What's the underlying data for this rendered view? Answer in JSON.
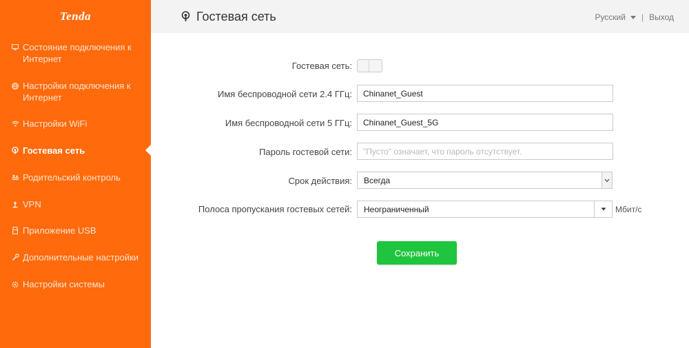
{
  "brand": {
    "logo_text": "Tenda",
    "accent_color": "#ff6a0c"
  },
  "sidebar": {
    "items": [
      {
        "label": "Состояние подключения к Интернет",
        "icon": "monitor-icon",
        "active": false
      },
      {
        "label": "Настройки подключения к Интернет",
        "icon": "globe-icon",
        "active": false
      },
      {
        "label": "Настройки WiFi",
        "icon": "wifi-icon",
        "active": false
      },
      {
        "label": "Гостевая сеть",
        "icon": "guest-network-icon",
        "active": true
      },
      {
        "label": "Родительский контроль",
        "icon": "parental-control-icon",
        "active": false
      },
      {
        "label": "VPN",
        "icon": "vpn-icon",
        "active": false
      },
      {
        "label": "Приложение USB",
        "icon": "usb-icon",
        "active": false
      },
      {
        "label": "Дополнительные настройки",
        "icon": "wrench-icon",
        "active": false
      },
      {
        "label": "Настройки системы",
        "icon": "gear-icon",
        "active": false
      }
    ]
  },
  "header": {
    "title": "Гостевая сеть",
    "title_icon": "guest-network-icon",
    "language": "Русский",
    "separator": "|",
    "logout": "Выход"
  },
  "form": {
    "guest_network": {
      "label": "Гостевая сеть:",
      "enabled": false
    },
    "ssid_24": {
      "label": "Имя беспроводной сети 2.4 ГГц:",
      "value": "Chinanet_Guest"
    },
    "ssid_5": {
      "label": "Имя беспроводной сети 5 ГГц:",
      "value": "Chinanet_Guest_5G"
    },
    "password": {
      "label": "Пароль гостевой сети:",
      "value": "",
      "placeholder": "\"Пусто\" означает, что пароль отсутствует."
    },
    "validity": {
      "label": "Срок действия:",
      "value": "Всегда"
    },
    "bandwidth": {
      "label": "Полоса пропускания гостевых сетей:",
      "value": "Неограниченный",
      "unit": "Мбит/с"
    },
    "save_label": "Сохранить",
    "save_color": "#1fc53e"
  }
}
